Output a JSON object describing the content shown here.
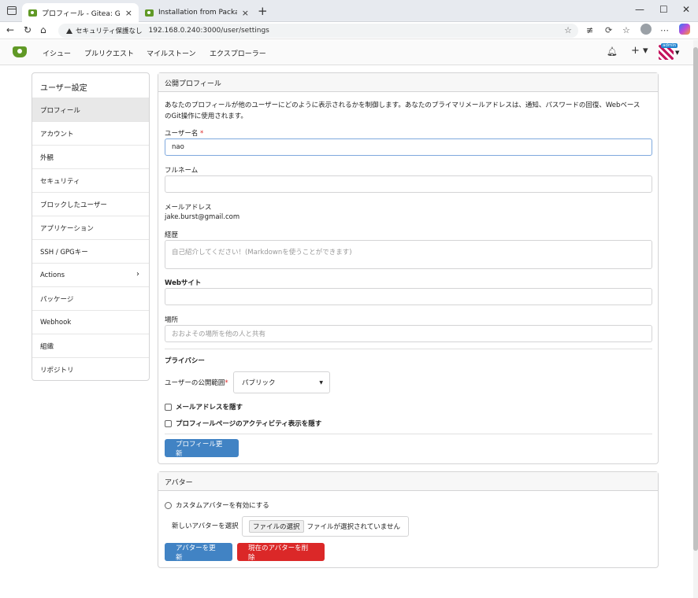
{
  "browser": {
    "tabs": [
      {
        "title": "プロフィール - Gitea: Git with a cup o",
        "active": true
      },
      {
        "title": "Installation from Package | Gitea D",
        "active": false
      }
    ],
    "insecure_label": "セキュリティ保護なし",
    "url": "192.168.0.240:3000/user/settings"
  },
  "gitea_nav": {
    "items": [
      "イシュー",
      "プルリクエスト",
      "マイルストーン",
      "エクスプローラー"
    ],
    "avatar_badge": "admin"
  },
  "sidebar": {
    "header": "ユーザー設定",
    "items": [
      {
        "label": "プロフィール",
        "active": true
      },
      {
        "label": "アカウント"
      },
      {
        "label": "外観"
      },
      {
        "label": "セキュリティ"
      },
      {
        "label": "ブロックしたユーザー"
      },
      {
        "label": "アプリケーション"
      },
      {
        "label": "SSH / GPGキー"
      },
      {
        "label": "Actions",
        "has_submenu": true
      },
      {
        "label": "パッケージ"
      },
      {
        "label": "Webhook"
      },
      {
        "label": "組織"
      },
      {
        "label": "リポジトリ"
      }
    ]
  },
  "profile": {
    "title": "公開プロフィール",
    "description_line1": "あなたのプロフィールが他のユーザーにどのように表示されるかを制御します。あなたのプライマリメールアドレスは、通知、パスワードの回復、Webベース",
    "description_line2": "のGit操作に使用されます。",
    "username_label": "ユーザー名",
    "username_required": "*",
    "username_value": "nao",
    "fullname_label": "フルネーム",
    "fullname_value": "",
    "email_label": "メールアドレス",
    "email_value": "jake.burst@gmail.com",
    "bio_label": "経歴",
    "bio_placeholder": "自己紹介してください！(Markdownを使うことができます)",
    "website_label": "Webサイト",
    "website_value": "",
    "location_label": "場所",
    "location_placeholder": "おおよその場所を他の人と共有",
    "privacy_heading": "プライバシー",
    "visibility_label": "ユーザーの公開範囲",
    "visibility_required": "*",
    "visibility_value": "パブリック",
    "hide_email_label": "メールアドレスを隠す",
    "hide_activity_label": "プロフィールページのアクティビティ表示を隠す",
    "update_button": "プロフィール更新"
  },
  "avatar_panel": {
    "title": "アバター",
    "custom_avatar_label": "カスタムアバターを有効にする",
    "new_avatar_label": "新しいアバターを選択",
    "file_button": "ファイルの選択",
    "file_status": "ファイルが選択されていません",
    "update_button": "アバターを更新",
    "delete_button": "現在のアバターを削除"
  },
  "colors": {
    "primary": "#4183c4",
    "danger": "#db2828",
    "gitea_green": "#609926"
  }
}
